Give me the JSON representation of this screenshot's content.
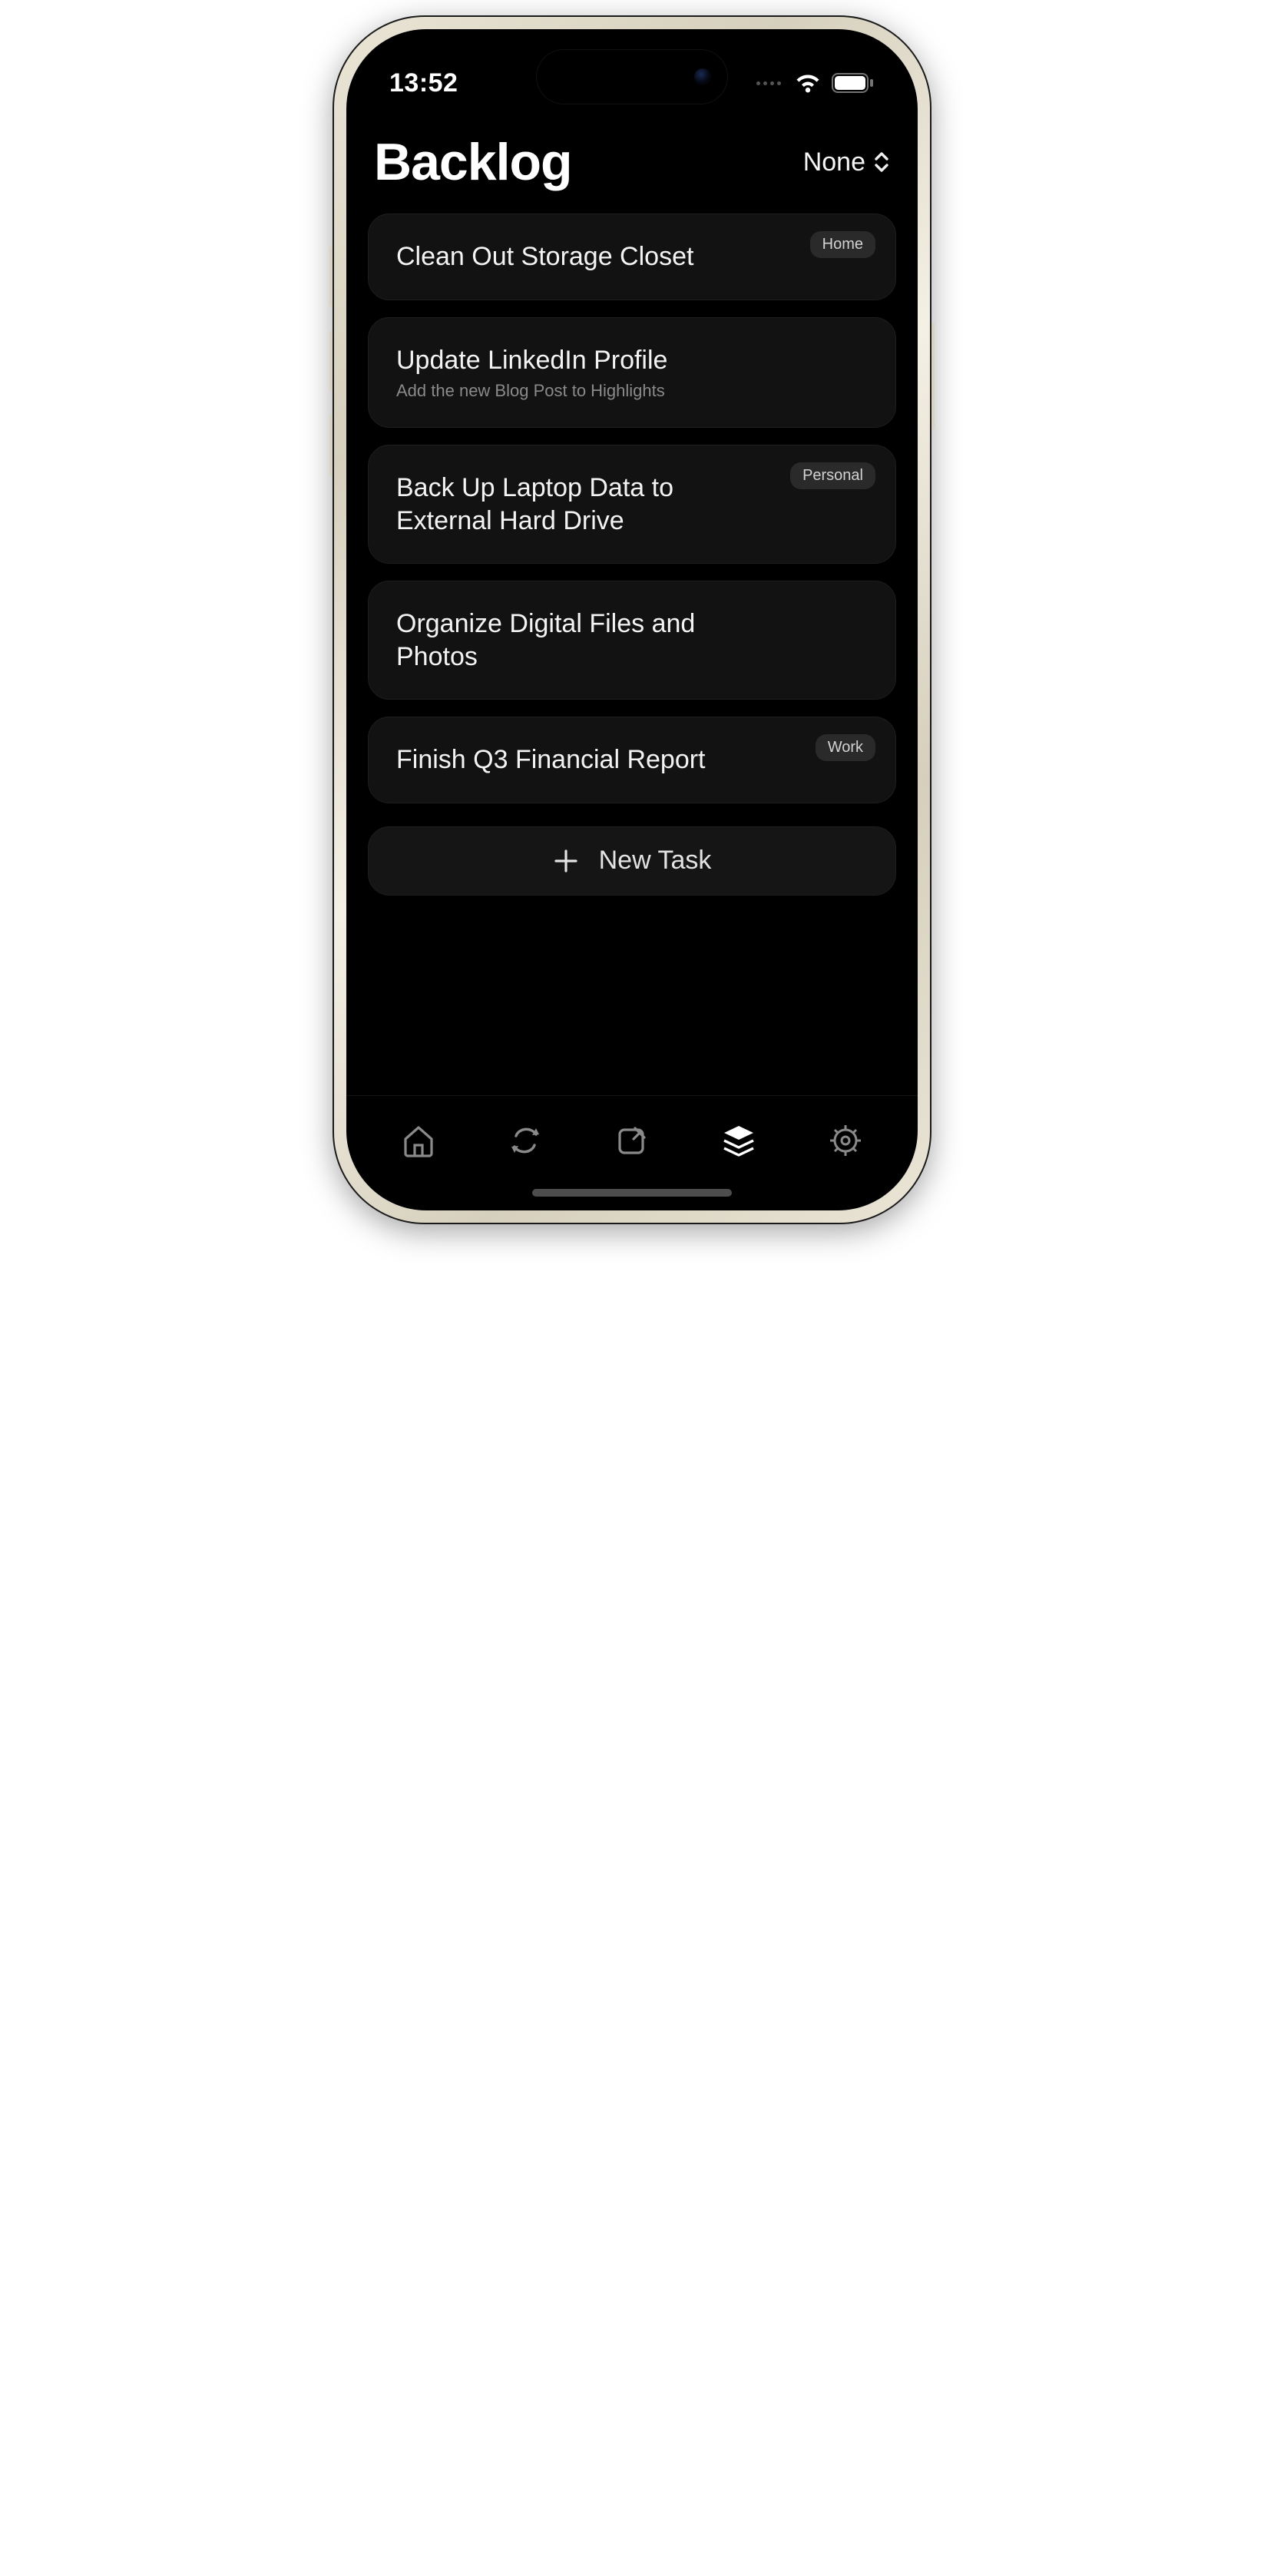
{
  "status": {
    "time": "13:52"
  },
  "header": {
    "title": "Backlog",
    "filter_label": "None"
  },
  "tasks": [
    {
      "title": "Clean Out Storage Closet",
      "subtitle": "",
      "tag": "Home"
    },
    {
      "title": "Update LinkedIn Profile",
      "subtitle": "Add the new Blog Post to Highlights",
      "tag": ""
    },
    {
      "title": "Back Up Laptop Data to External Hard Drive",
      "subtitle": "",
      "tag": "Personal"
    },
    {
      "title": "Organize Digital Files and Photos",
      "subtitle": "",
      "tag": ""
    },
    {
      "title": "Finish Q3 Financial Report",
      "subtitle": "",
      "tag": "Work"
    }
  ],
  "new_task_label": "New Task",
  "tabbar": {
    "items": [
      {
        "name": "home"
      },
      {
        "name": "cycles"
      },
      {
        "name": "compose"
      },
      {
        "name": "stack"
      },
      {
        "name": "settings"
      }
    ],
    "active_index": 3
  }
}
